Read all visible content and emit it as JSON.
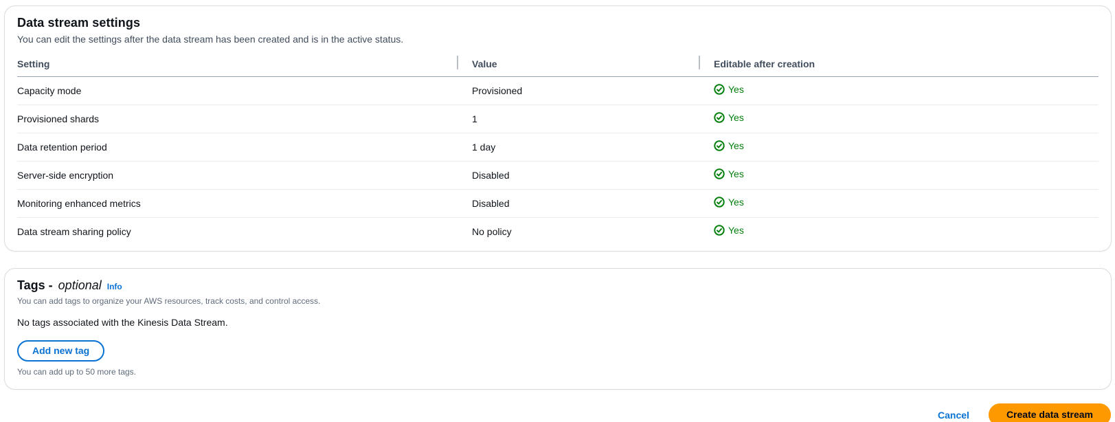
{
  "colors": {
    "link-blue": "#0972d3",
    "primary-orange": "#ff9900",
    "success-green": "#037f0c",
    "border-color": "#d9dce1"
  },
  "settings_card": {
    "title": "Data stream settings",
    "description": "You can edit the settings after the data stream has been created and is in the active status.",
    "table": {
      "columns": [
        "Setting",
        "Value",
        "Editable after creation"
      ],
      "rows": [
        {
          "setting": "Capacity mode",
          "value": "Provisioned",
          "editable": "Yes"
        },
        {
          "setting": "Provisioned shards",
          "value": "1",
          "editable": "Yes"
        },
        {
          "setting": "Data retention period",
          "value": "1 day",
          "editable": "Yes"
        },
        {
          "setting": "Server-side encryption",
          "value": "Disabled",
          "editable": "Yes"
        },
        {
          "setting": "Monitoring enhanced metrics",
          "value": "Disabled",
          "editable": "Yes"
        },
        {
          "setting": "Data stream sharing policy",
          "value": "No policy",
          "editable": "Yes"
        }
      ]
    }
  },
  "tags_card": {
    "title_main": "Tags -",
    "title_optional": "optional",
    "info_label": "Info",
    "description": "You can add tags to organize your AWS resources, track costs, and control access.",
    "empty_message": "No tags associated with the Kinesis Data Stream.",
    "add_button_label": "Add new tag",
    "limit_message": "You can add up to 50 more tags."
  },
  "footer": {
    "cancel_label": "Cancel",
    "create_label": "Create data stream"
  }
}
